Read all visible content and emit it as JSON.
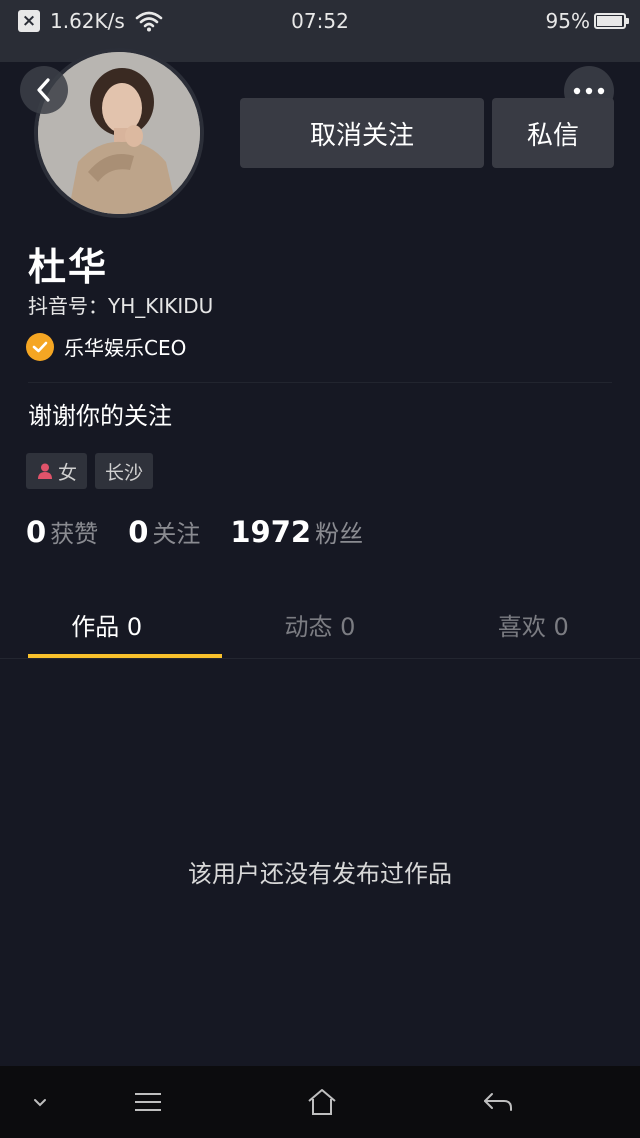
{
  "status_bar": {
    "network_speed": "1.62K/s",
    "time": "07:52",
    "battery": "95%",
    "battery_level": 0.95
  },
  "profile": {
    "name": "杜华",
    "douyin_id": "抖音号：YH_KIKIDU",
    "verification": "乐华娱乐CEO",
    "bio": "谢谢你的关注",
    "tags": {
      "gender": "女",
      "location": "长沙"
    }
  },
  "actions": {
    "unfollow_label": "取消关注",
    "message_label": "私信"
  },
  "stats": [
    {
      "value": "0",
      "label": "获赞"
    },
    {
      "value": "0",
      "label": "关注"
    },
    {
      "value": "1972",
      "label": "粉丝"
    }
  ],
  "tabs": [
    {
      "label": "作品 0",
      "active": true
    },
    {
      "label": "动态 0",
      "active": false
    },
    {
      "label": "喜欢 0",
      "active": false
    }
  ],
  "empty_message": "该用户还没有发布过作品",
  "colors": {
    "background": "#161823",
    "accent_yellow": "#f8c12c",
    "verify_badge": "#f5a623",
    "female_icon": "#e0536a"
  },
  "icons": {
    "back": "chevron-left-icon",
    "more": "more-dots-icon",
    "verify": "checkmark-badge-icon",
    "gender": "female-person-icon",
    "nav": [
      "chevron-down-icon",
      "menu-icon",
      "home-icon",
      "back-arrow-icon"
    ]
  }
}
